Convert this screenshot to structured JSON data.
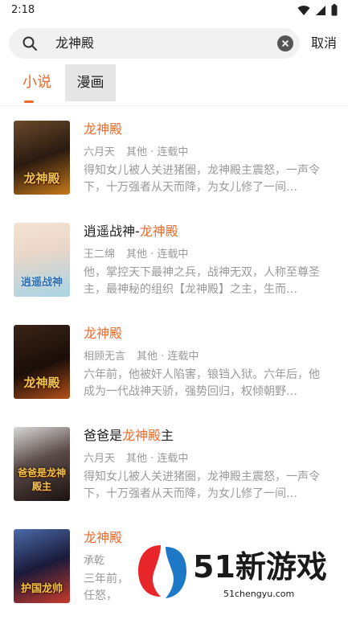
{
  "status": {
    "time": "2:18"
  },
  "search": {
    "query": "龙神殿",
    "cancel": "取消"
  },
  "tabs": [
    {
      "label": "小说"
    },
    {
      "label": "漫画"
    }
  ],
  "results": [
    {
      "cover_title": "龙神殿",
      "title_prefix": "",
      "title_highlight": "龙神殿",
      "title_suffix": "",
      "author": "六月天",
      "category": "其他 · 连载中",
      "desc": "得知女儿被人关进猪圈，龙神殿主震怒，一声令下，十万强者从天而降，为女儿修了一间…"
    },
    {
      "cover_title": "逍遥战神",
      "title_prefix": "逍遥战神-",
      "title_highlight": "龙神殿",
      "title_suffix": "",
      "author": "王二绵",
      "category": "其他 · 连载中",
      "desc": "他，掌控天下最神之兵，战神无双，人称至尊圣主，最神秘的组织【龙神殿】之主，生而…"
    },
    {
      "cover_title": "龙神殿",
      "title_prefix": "",
      "title_highlight": "龙神殿",
      "title_suffix": "",
      "author": "相顾无言",
      "category": "其他 · 连载中",
      "desc": "六年前，他被奸人陷害，锒铛入狱。六年后，他成为一代战神天骄，强势回归，权倾朝野…"
    },
    {
      "cover_title": "爸爸是龙神殿主",
      "title_prefix": "爸爸是",
      "title_highlight": "龙神殿",
      "title_suffix": "主",
      "author": "六月天",
      "category": "其他 · 连载中",
      "desc": "得知女儿被人关进猪圈，龙神殿主震怒，一声令下，十万强者从天而降，为女儿修了一间…"
    },
    {
      "cover_title": "护国龙帅",
      "title_prefix": "",
      "title_highlight": "龙神殿",
      "title_suffix": "",
      "author": "承乾",
      "category": "其他 · 连载中",
      "desc": "三年前，任怒，"
    }
  ],
  "watermark": {
    "brand": "51新游戏",
    "url": "51chengyu.com"
  },
  "colors": {
    "accent": "#ee6a2a",
    "muted": "#999999"
  }
}
